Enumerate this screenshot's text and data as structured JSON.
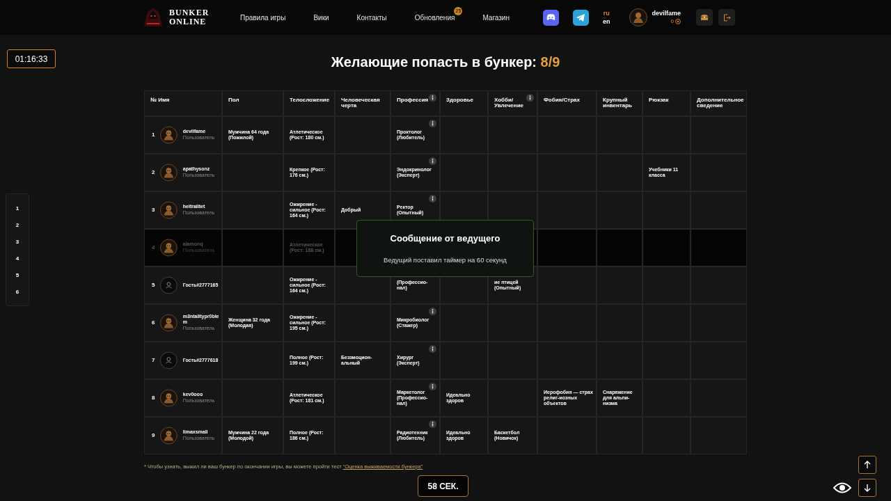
{
  "header": {
    "logo_lines": [
      "BUNKER",
      "ONLINE"
    ],
    "nav": [
      {
        "label": "Правила игры"
      },
      {
        "label": "Вики"
      },
      {
        "label": "Контакты"
      },
      {
        "label": "Обновления",
        "badge": "25"
      },
      {
        "label": "Магазин"
      }
    ],
    "languages": [
      {
        "label": "ru",
        "selected": true
      },
      {
        "label": "en",
        "selected": false
      }
    ],
    "user": {
      "name": "devilfame",
      "coins": "0"
    }
  },
  "timer": "01:16:33",
  "title": "Желающие попасть в бункер: ",
  "count": "8/9",
  "columns": [
    {
      "label": "№ Имя",
      "info": false
    },
    {
      "label": "Пол",
      "info": false
    },
    {
      "label": "Телосложение",
      "info": false
    },
    {
      "label": "Человеческая черта",
      "info": false
    },
    {
      "label": "Профессия",
      "info": true
    },
    {
      "label": "Здоровье",
      "info": false
    },
    {
      "label": "Хобби/ Увлечение",
      "info": true
    },
    {
      "label": "Фобия/Страх",
      "info": false
    },
    {
      "label": "Крупный инвентарь",
      "info": false
    },
    {
      "label": "Рюкзак",
      "info": false
    },
    {
      "label": "Дополнительное сведение",
      "info": false
    }
  ],
  "rows": [
    {
      "number": "1",
      "name": "devilfame",
      "role": "Пользователь",
      "kind": "user",
      "dimmed": false,
      "info": true,
      "cells": [
        "Мужчина 64 года (Пожилой)",
        "Атлетическое (Рост: 180 см.)",
        null,
        "Проктолог (Любитель)",
        null,
        null,
        null,
        null,
        null,
        null
      ]
    },
    {
      "number": "2",
      "name": "apathysonz",
      "role": "Пользователь",
      "kind": "user",
      "dimmed": false,
      "info": true,
      "cells": [
        null,
        "Крепкое (Рост: 176 см.)",
        null,
        "Эндокринолог (Эксперт)",
        null,
        null,
        null,
        null,
        "Учебники 11 класса",
        null
      ]
    },
    {
      "number": "3",
      "name": "heitralitet",
      "role": "Пользователь",
      "kind": "user",
      "dimmed": false,
      "info": true,
      "cells": [
        null,
        "Ожирение - сильное (Рост: 164 см.)",
        "Добрый",
        "Ректор (Опытный)",
        null,
        null,
        null,
        null,
        null,
        null
      ]
    },
    {
      "number": "4",
      "name": "alamonq",
      "role": "Пользователь",
      "kind": "user",
      "dimmed": true,
      "info": false,
      "cells": [
        null,
        "Атлетическое (Рост: 188 см.)",
        null,
        null,
        null,
        null,
        null,
        null,
        null,
        null
      ]
    },
    {
      "number": "5",
      "name": "Гость#2777165",
      "kind": "guest",
      "dimmed": false,
      "info": false,
      "cells": [
        null,
        "Ожирение - сильное (Рост: 164 см.)",
        null,
        "(Профессио-нал)",
        null,
        "ие птицей (Опытный)",
        null,
        null,
        null,
        null
      ]
    },
    {
      "number": "6",
      "name": "m3ntalitypr0blem",
      "role": "Пользователь",
      "kind": "user",
      "dimmed": false,
      "info": true,
      "cells": [
        "Женщина 32 года (Молодая)",
        "Ожирение - сильное (Рост: 195 см.)",
        null,
        "Микробиолог (Стажер)",
        null,
        null,
        null,
        null,
        null,
        null
      ]
    },
    {
      "number": "7",
      "name": "Гость#2777618",
      "kind": "guest",
      "dimmed": false,
      "info": true,
      "cells": [
        null,
        "Полное (Рост: 199 см.)",
        "Беззмоцион-альный",
        "Хирург (Эксперт)",
        null,
        null,
        null,
        null,
        null,
        null
      ]
    },
    {
      "number": "8",
      "name": "kev0ooo",
      "role": "Пользователь",
      "kind": "user",
      "dimmed": false,
      "info": true,
      "cells": [
        null,
        "Атлетическое (Рост: 181 см.)",
        null,
        "Маркетолог (Профессио-нал)",
        "Идеально здоров",
        null,
        "Иерофобия — страх религ-иозных объектов",
        "Снаряжение для альпи-низма",
        null,
        null
      ]
    },
    {
      "number": "9",
      "name": "limaxsmall",
      "role": "Пользователь",
      "kind": "user",
      "dimmed": false,
      "info": true,
      "cells": [
        "Мужчина 22 года (Молодой)",
        "Полное (Рост: 186 см.)",
        null,
        "Радиотехник (Любитель)",
        "Идеально здоров",
        "Баскетбол (Новичок)",
        null,
        null,
        null,
        null
      ]
    }
  ],
  "modal": {
    "title": "Сообщение от ведущего",
    "text": "Ведущий поставил таймер на 60 секунд"
  },
  "note": {
    "text": "* Чтобы узнать, выжил ли ваш бункер по окончании игры, вы можете пройти тест ",
    "link": "“Оценка выживаемости бункера”"
  },
  "countdown": "58 СЕК.",
  "side_nav": [
    "1",
    "2",
    "3",
    "4",
    "5",
    "6"
  ]
}
